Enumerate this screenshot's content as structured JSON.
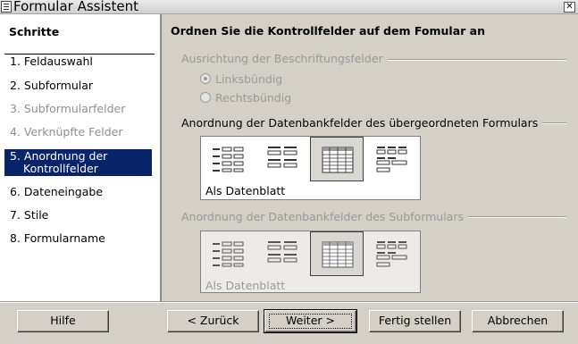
{
  "window": {
    "title": "Formular Assistent",
    "close_glyph": "✕"
  },
  "sidebar": {
    "title": "Schritte",
    "steps": [
      {
        "label": "1. Feldauswahl",
        "state": "normal"
      },
      {
        "label": "2. Subformular",
        "state": "normal"
      },
      {
        "label": "3. Subformularfelder",
        "state": "disabled"
      },
      {
        "label": "4. Verknüpfte Felder",
        "state": "disabled"
      },
      {
        "label_line1": "5.  Anordnung der",
        "label_line2": "Kontrollfelder",
        "state": "active"
      },
      {
        "label": "6. Dateneingabe",
        "state": "normal"
      },
      {
        "label": "7. Stile",
        "state": "normal"
      },
      {
        "label": "8. Formularname",
        "state": "normal"
      }
    ]
  },
  "main": {
    "title": "Ordnen Sie die Kontrollfelder auf dem Fomular an",
    "label_alignment": {
      "heading": "Ausrichtung der Beschriftungsfelder",
      "options": [
        {
          "label": "Linksbündig",
          "checked": true
        },
        {
          "label": "Rechtsbündig",
          "checked": false
        }
      ]
    },
    "main_form_layout": {
      "heading": "Anordnung der Datenbankfelder des übergeordneten Formulars",
      "caption": "Als Datenblatt",
      "selected_icon": "tabular-layout-icon"
    },
    "subform_layout": {
      "heading": "Anordnung der Datenbankfelder des Subformulars",
      "caption": "Als Datenblatt",
      "selected_icon": "tabular-layout-icon"
    }
  },
  "buttons": {
    "help": "Hilfe",
    "back": "< Zurück",
    "next": "Weiter >",
    "finish": "Fertig stellen",
    "cancel": "Abbrechen"
  },
  "colors": {
    "dialog_bg": "#d4d0c8",
    "active_step_bg": "#0a246a",
    "disabled_text": "#9a9a9a"
  }
}
